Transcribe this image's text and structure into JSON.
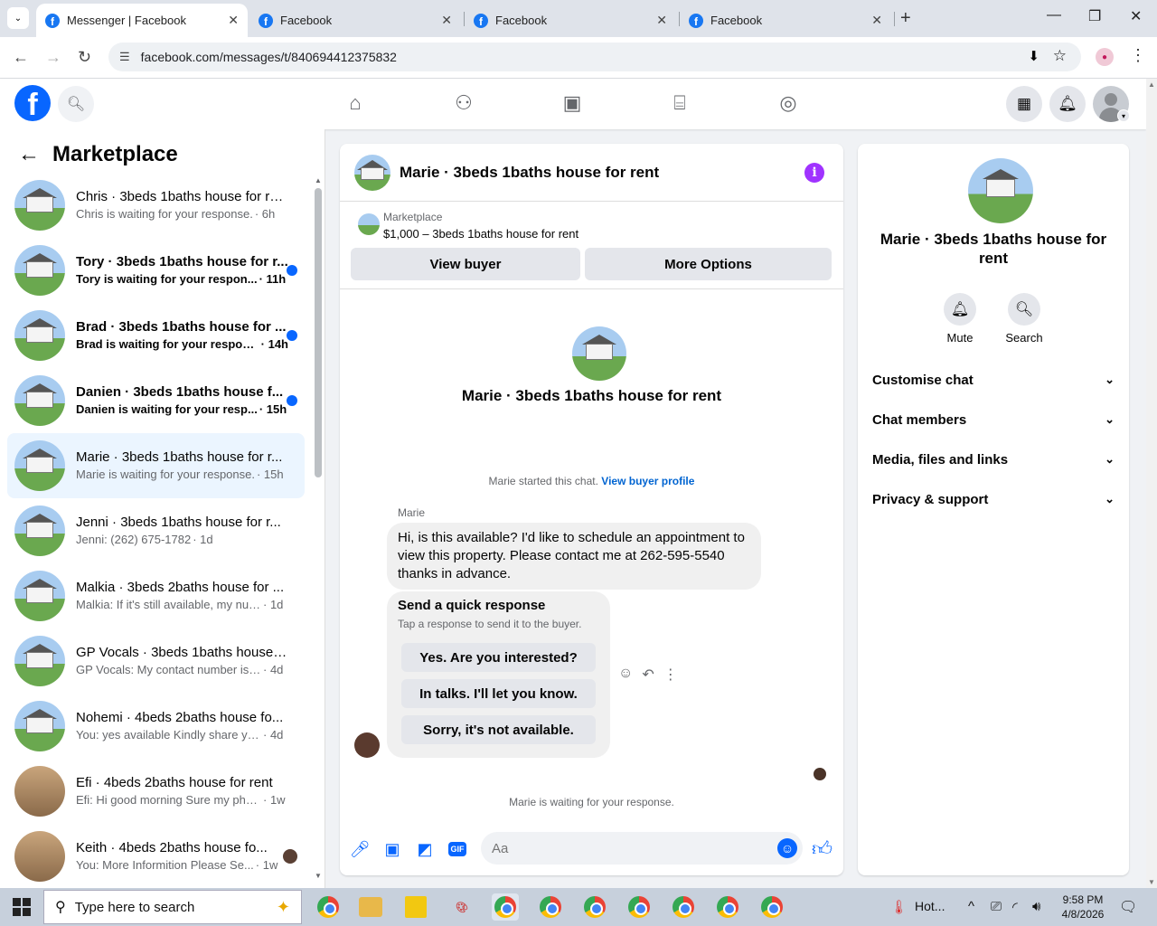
{
  "browser": {
    "tabs": [
      {
        "title": "Messenger | Facebook",
        "active": true
      },
      {
        "title": "Facebook",
        "active": false
      },
      {
        "title": "Facebook",
        "active": false
      },
      {
        "title": "Facebook",
        "active": false
      }
    ],
    "url": "facebook.com/messages/t/840694412375832"
  },
  "sidebar": {
    "title": "Marketplace",
    "conversations": [
      {
        "name": "Chris · 3beds 1baths house for re...",
        "preview": "Chris is waiting for your response.",
        "time": "· 6h",
        "unread": false,
        "selected": false
      },
      {
        "name": "Tory · 3beds 1baths house for r...",
        "preview": "Tory is waiting for your respon...",
        "time": "· 11h",
        "unread": true,
        "selected": false
      },
      {
        "name": "Brad · 3beds 1baths house for ...",
        "preview": "Brad is waiting for your respon...",
        "time": "· 14h",
        "unread": true,
        "selected": false
      },
      {
        "name": "Danien · 3beds 1baths house f...",
        "preview": "Danien is waiting for your resp...",
        "time": "· 15h",
        "unread": true,
        "selected": false
      },
      {
        "name": "Marie · 3beds 1baths house for r...",
        "preview": "Marie is waiting for your response.",
        "time": "· 15h",
        "unread": false,
        "selected": true
      },
      {
        "name": "Jenni · 3beds 1baths house for r...",
        "preview": "Jenni: (262) 675-1782",
        "time": "· 1d",
        "unread": false,
        "selected": false
      },
      {
        "name": "Malkia · 3beds 2baths house for ...",
        "preview": "Malkia: If it's still available, my num...",
        "time": "· 1d",
        "unread": false,
        "selected": false
      },
      {
        "name": "GP Vocals · 3beds 1baths house f...",
        "preview": "GP Vocals: My contact number is 2...",
        "time": "· 4d",
        "unread": false,
        "selected": false
      },
      {
        "name": "Nohemi · 4beds 2baths house fo...",
        "preview": "You: yes available Kindly share your...",
        "time": "· 4d",
        "unread": false,
        "selected": false
      },
      {
        "name": "Efi · 4beds 2baths house for rent",
        "preview": "Efi: Hi good morning Sure my pho...",
        "time": "· 1w",
        "unread": false,
        "selected": false
      },
      {
        "name": "Keith · 4beds 2baths house fo...",
        "preview": "You: More Informition Please Se...",
        "time": "· 1w",
        "unread": false,
        "selected": false
      }
    ]
  },
  "chat": {
    "title": "Marie · 3beds 1baths house for rent",
    "marketplace_label": "Marketplace",
    "listing": "$1,000 – 3beds 1baths house for rent",
    "view_buyer": "View buyer",
    "more_options": "More Options",
    "started_text": "Marie started this chat.",
    "buyer_profile_link": "View buyer profile",
    "sender": "Marie",
    "message": "Hi, is this available? I'd like to schedule an appointment to view this property. Please contact me at  262-595-5540 thanks in advance.",
    "quick_title": "Send a quick response",
    "quick_sub": "Tap a response to send it to the buyer.",
    "quick_responses": [
      "Yes. Are you interested?",
      "In talks. I'll let you know.",
      "Sorry, it's not available."
    ],
    "waiting": "Marie is waiting for your response.",
    "input_placeholder": "Aa"
  },
  "details": {
    "title": "Marie · 3beds 1baths house for rent",
    "mute": "Mute",
    "search": "Search",
    "sections": [
      "Customise chat",
      "Chat members",
      "Media, files and links",
      "Privacy & support"
    ]
  },
  "taskbar": {
    "search_placeholder": "Type here to search",
    "weather": "Hot...",
    "time": "9:58 PM",
    "date": "4/8/2026"
  }
}
